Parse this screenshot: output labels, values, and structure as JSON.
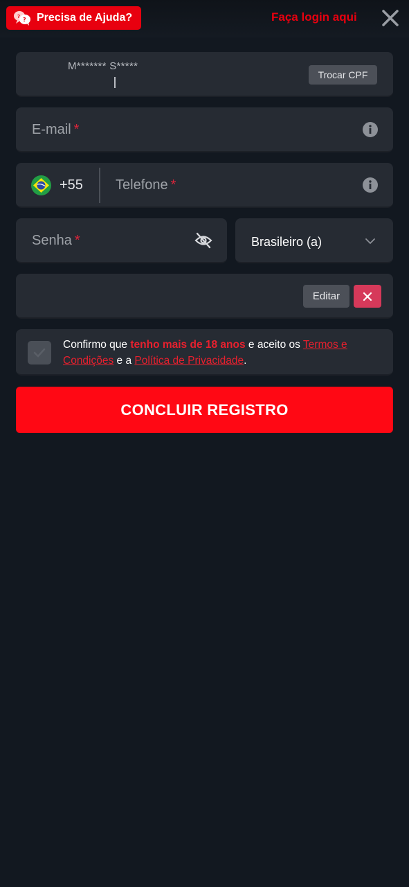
{
  "header": {
    "help_label": "Precisa de Ajuda?",
    "login_label": "Faça login aqui"
  },
  "cpf": {
    "masked_name": "M******* S*****",
    "swap_label": "Trocar CPF"
  },
  "email": {
    "placeholder": "E-mail",
    "required_mark": "*"
  },
  "phone": {
    "dial_code": "+55",
    "placeholder": "Telefone",
    "required_mark": "*"
  },
  "password": {
    "placeholder": "Senha",
    "required_mark": "*"
  },
  "nationality": {
    "value": "Brasileiro (a)"
  },
  "promo": {
    "edit_label": "Editar"
  },
  "terms": {
    "part1": "Confirmo que ",
    "highlight": "tenho mais de 18 anos",
    "part2": " e aceito os ",
    "terms_link": "Termos e Condições",
    "part3": " e a ",
    "privacy_link": "Política de Privacidade",
    "part4": "."
  },
  "submit": {
    "label": "CONCLUIR REGISTRO"
  },
  "colors": {
    "accent_red": "#e8000f",
    "background": "#121820",
    "field_bg": "#262b33"
  }
}
